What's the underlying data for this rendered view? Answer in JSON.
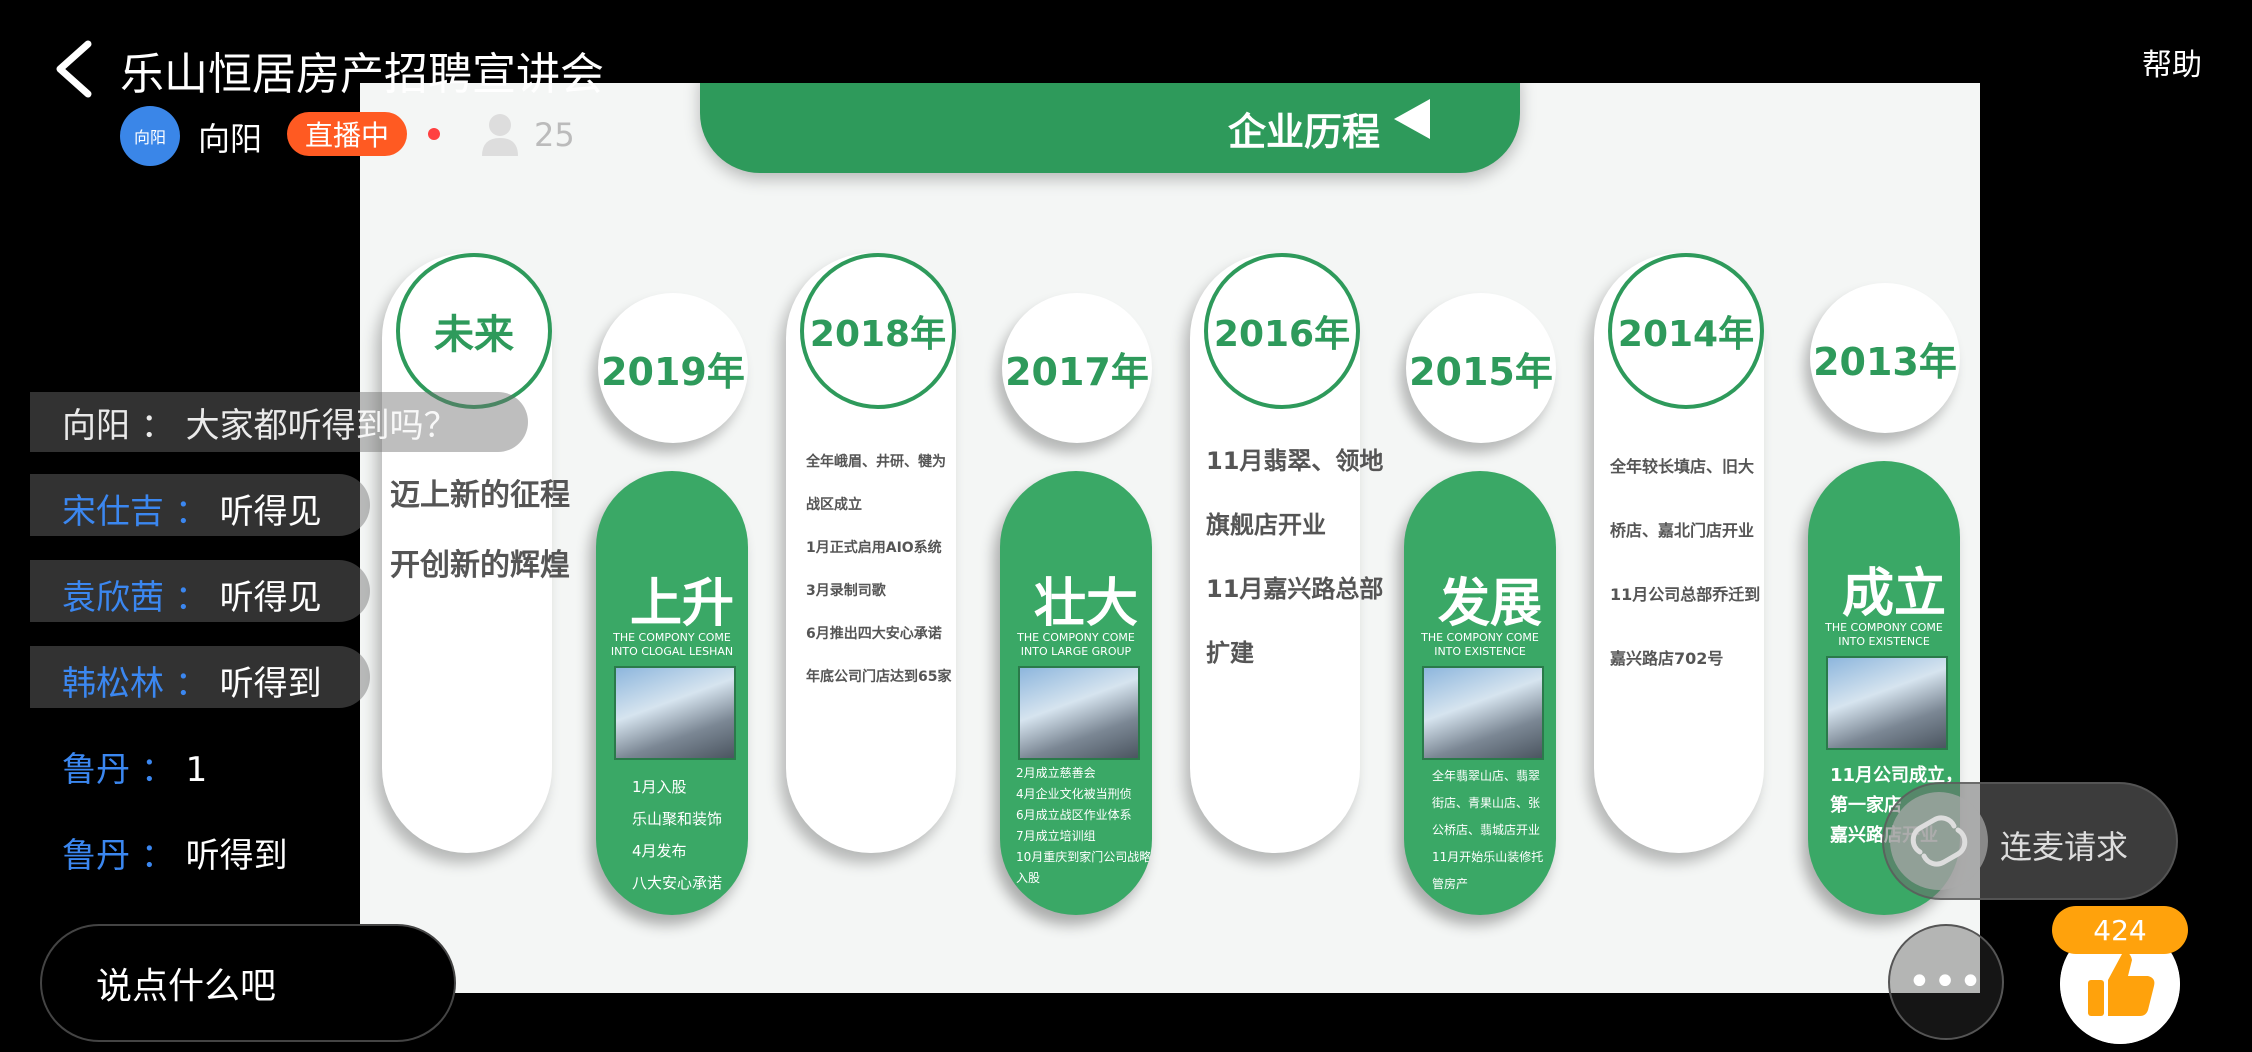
{
  "header": {
    "title": "乐山恒居房产招聘宣讲会",
    "help_label": "帮助"
  },
  "host": {
    "avatar_text": "向阳",
    "name": "向阳",
    "live_label": "直播中",
    "viewer_count": "25"
  },
  "slide": {
    "banner_title": "企业历程",
    "future": {
      "label": "未来",
      "lines": [
        "迈上新的征程",
        "开创新的辉煌"
      ]
    },
    "year2019": {
      "year": "2019年",
      "big": "上升",
      "sub": "THE COMPONY COME INTO CLOGAL LESHAN",
      "lines": [
        "1月入股",
        "乐山聚和装饰",
        "4月发布",
        "八大安心承诺"
      ]
    },
    "year2018": {
      "year": "2018年",
      "lines": [
        "全年峨眉、井研、犍为",
        "战区成立",
        "1月正式启用AIO系统",
        "3月录制司歌",
        "6月推出四大安心承诺",
        "年底公司门店达到65家"
      ]
    },
    "year2017": {
      "year": "2017年",
      "big": "壮大",
      "sub": "THE COMPONY COME INTO LARGE GROUP",
      "lines": [
        "2月成立慈善会",
        "4月企业文化被当刑侦",
        "6月成立战区作业体系",
        "7月成立培训组",
        "10月重庆到家门公司战略",
        "入股"
      ]
    },
    "year2016": {
      "year": "2016年",
      "lines": [
        "11月翡翠、领地",
        "旗舰店开业",
        "11月嘉兴路总部",
        "扩建"
      ]
    },
    "year2015": {
      "year": "2015年",
      "big": "发展",
      "sub": "THE COMPONY COME INTO EXISTENCE",
      "lines": [
        "全年翡翠山店、翡翠",
        "街店、青果山店、张",
        "公桥店、翡城店开业",
        "11月开始乐山装修托",
        "管房产"
      ]
    },
    "year2014": {
      "year": "2014年",
      "lines": [
        "全年较长填店、旧大",
        "桥店、嘉北门店开业",
        "11月公司总部乔迁到",
        "嘉兴路店702号"
      ]
    },
    "year2013": {
      "year": "2013年",
      "big": "成立",
      "sub": "THE COMPONY COME INTO EXISTENCE",
      "lines": [
        "11月公司成立，",
        "第一家店",
        "嘉兴路店开业"
      ]
    }
  },
  "chat": {
    "partial": "向阳 ： 大家都听得到吗？",
    "messages": [
      {
        "user": "宋仕吉",
        "sep": "：",
        "text": "听得见"
      },
      {
        "user": "袁欣茜",
        "sep": "：",
        "text": "听得见"
      },
      {
        "user": "韩松林",
        "sep": "：",
        "text": "听得到"
      },
      {
        "user": "鲁丹",
        "sep": "：",
        "text": "1"
      },
      {
        "user": "鲁丹",
        "sep": "：",
        "text": "听得到"
      }
    ]
  },
  "controls": {
    "comment_placeholder": "说点什么吧",
    "connect_label": "连麦请求",
    "more_label": "•••",
    "like_count": "424"
  },
  "icons": [
    "back-arrow-icon",
    "user-icon",
    "connect-mic-icon",
    "thumbs-up-icon",
    "more-icon"
  ],
  "colors": {
    "brand_green": "#2e9a5b",
    "live_orange": "#ff5a22",
    "like_orange": "#ffa20c",
    "chat_user_blue": "#3b87f0"
  }
}
